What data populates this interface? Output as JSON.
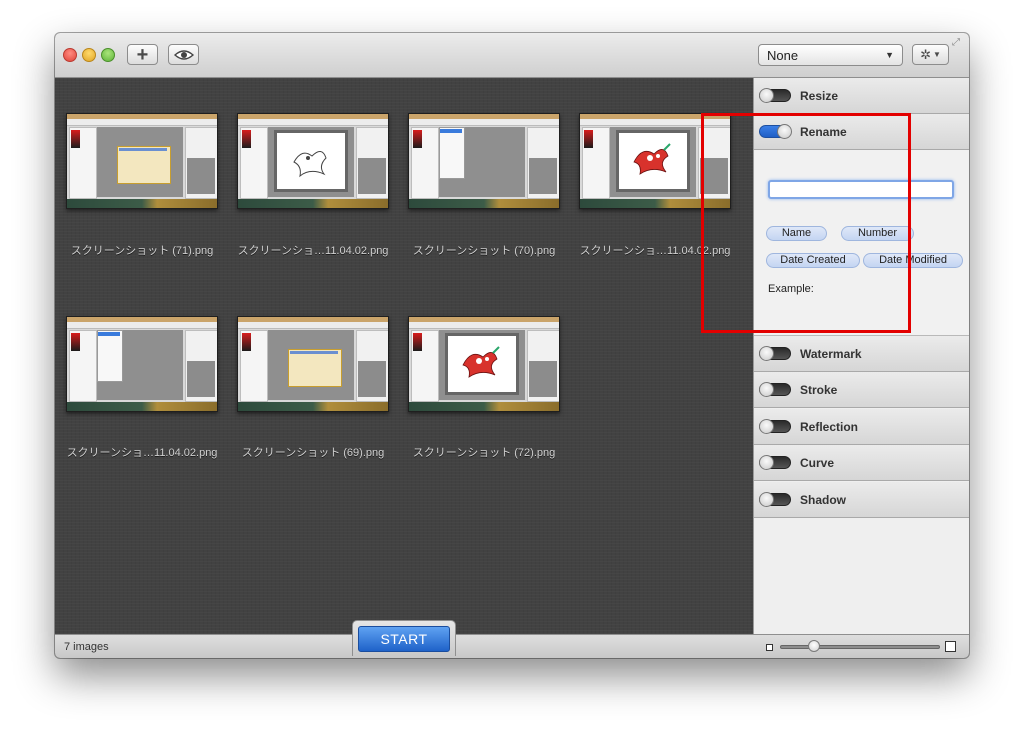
{
  "toolbar": {
    "preset_value": "None",
    "add_icon": "plus-icon",
    "preview_icon": "eye-icon",
    "gear_icon": "gear-icon"
  },
  "images": [
    {
      "caption": "スクリーンショット (71).png",
      "style": "dialog"
    },
    {
      "caption": "スクリーンショ…11.04.02.png",
      "style": "sketch"
    },
    {
      "caption": "スクリーンショット (70).png",
      "style": "menu"
    },
    {
      "caption": "スクリーンショ…11.04.02.png",
      "style": "creature"
    },
    {
      "caption": "スクリーンショ…11.04.02.png",
      "style": "menu"
    },
    {
      "caption": "スクリーンショット (69).png",
      "style": "dialog"
    },
    {
      "caption": "スクリーンショット (72).png",
      "style": "creature"
    }
  ],
  "sidebar": {
    "resize": {
      "label": "Resize",
      "enabled": false
    },
    "rename": {
      "label": "Rename",
      "enabled": true,
      "input_value": "",
      "tokens": [
        "Name",
        "Number",
        "Date Created",
        "Date Modified"
      ],
      "example_label": "Example:"
    },
    "watermark": {
      "label": "Watermark",
      "enabled": false
    },
    "stroke": {
      "label": "Stroke",
      "enabled": false
    },
    "reflection": {
      "label": "Reflection",
      "enabled": false
    },
    "curve": {
      "label": "Curve",
      "enabled": false
    },
    "shadow": {
      "label": "Shadow",
      "enabled": false
    }
  },
  "status": {
    "count": "7 images",
    "start_label": "START"
  },
  "colors": {
    "accent": "#2f74dc",
    "highlight": "#e30000"
  }
}
